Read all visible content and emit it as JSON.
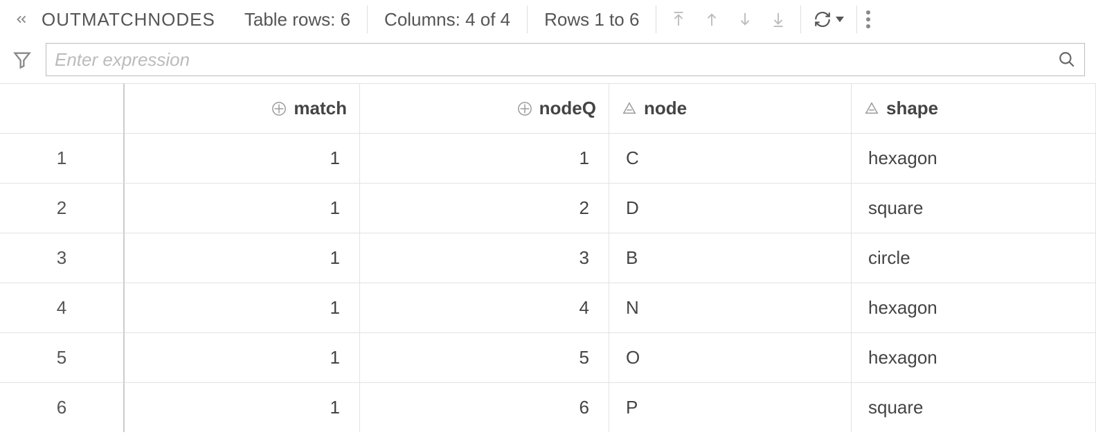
{
  "toolbar": {
    "title": "OUTMATCHNODES",
    "table_rows": "Table rows: 6",
    "columns": "Columns: 4 of 4",
    "rows_range": "Rows 1 to 6"
  },
  "filter": {
    "placeholder": "Enter expression"
  },
  "columns": [
    {
      "name": "match",
      "type": "numeric"
    },
    {
      "name": "nodeQ",
      "type": "numeric"
    },
    {
      "name": "node",
      "type": "text"
    },
    {
      "name": "shape",
      "type": "text"
    }
  ],
  "rows": [
    {
      "n": "1",
      "match": "1",
      "nodeQ": "1",
      "node": "C",
      "shape": "hexagon"
    },
    {
      "n": "2",
      "match": "1",
      "nodeQ": "2",
      "node": "D",
      "shape": "square"
    },
    {
      "n": "3",
      "match": "1",
      "nodeQ": "3",
      "node": "B",
      "shape": "circle"
    },
    {
      "n": "4",
      "match": "1",
      "nodeQ": "4",
      "node": "N",
      "shape": "hexagon"
    },
    {
      "n": "5",
      "match": "1",
      "nodeQ": "5",
      "node": "O",
      "shape": "hexagon"
    },
    {
      "n": "6",
      "match": "1",
      "nodeQ": "6",
      "node": "P",
      "shape": "square"
    }
  ]
}
